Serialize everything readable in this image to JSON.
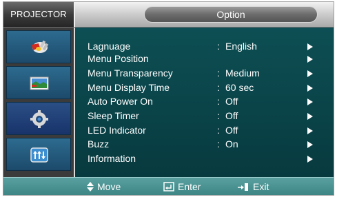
{
  "header": {
    "brand": "PROJECTOR",
    "title": "Option"
  },
  "sidebar": {
    "items": [
      {
        "icon": "plug-icon",
        "active": false
      },
      {
        "icon": "picture-icon",
        "active": false
      },
      {
        "icon": "gear-icon",
        "active": true
      },
      {
        "icon": "equalizer-icon",
        "active": false
      }
    ]
  },
  "menu": {
    "items": [
      {
        "label": "Lagnuage",
        "colon": ":",
        "value": "English"
      },
      {
        "label": "Menu Position",
        "colon": "",
        "value": ""
      },
      {
        "label": "Menu Transparency",
        "colon": ":",
        "value": "Medium"
      },
      {
        "label": "Menu Display Time",
        "colon": ":",
        "value": "60 sec"
      },
      {
        "label": "Auto Power On",
        "colon": ":",
        "value": "Off"
      },
      {
        "label": "Sleep Timer",
        "colon": ":",
        "value": "Off"
      },
      {
        "label": "LED Indicator",
        "colon": ":",
        "value": "Off"
      },
      {
        "label": "Buzz",
        "colon": ":",
        "value": "On"
      },
      {
        "label": "Information",
        "colon": "",
        "value": ""
      }
    ]
  },
  "footer": {
    "move": "Move",
    "enter": "Enter",
    "exit": "Exit"
  },
  "colors": {
    "panel": "#0b4a50",
    "bottom_bar": "#4a9393",
    "sidebar_item": "#245b80"
  }
}
